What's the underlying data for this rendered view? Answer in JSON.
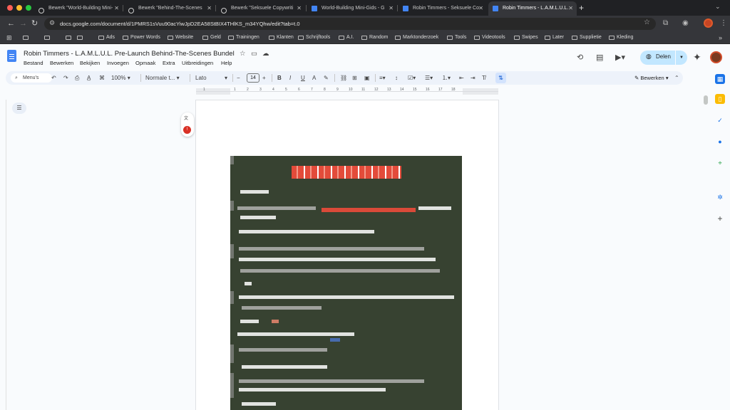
{
  "browser": {
    "tabs": [
      {
        "label": "Bewerk \"World-Building Mini-",
        "icon": "pencil-icon",
        "active": false
      },
      {
        "label": "Bewerk \"Behind-The-Scenes",
        "icon": "pencil-icon",
        "active": false
      },
      {
        "label": "Bewerk \"Seksuele Copywriti",
        "icon": "pencil-icon",
        "active": false
      },
      {
        "label": "World-Building Mini-Gids - G",
        "icon": "docs-icon",
        "active": false
      },
      {
        "label": "Robin Timmers - Seksuele Co",
        "icon": "docs-icon",
        "active": false
      },
      {
        "label": "Robin Timmers - L.A.M.L.U.L.",
        "icon": "docs-icon",
        "active": true
      }
    ],
    "new_tab": "+",
    "url": "docs.google.com/document/d/1PMRS1sVuu90acYiwJpD2EA58StBIX4THlKS_m34YQhw/edit?tab=t.0",
    "bookmarks": [
      "Ads",
      "Power Words",
      "Website",
      "Geld",
      "Trainingen",
      "Klanten",
      "Schrijftools",
      "A.I.",
      "Random",
      "Marktonderzoek",
      "Tools",
      "Videotools",
      "Swipes",
      "Later",
      "Supplietie",
      "Kleding"
    ]
  },
  "doc": {
    "title": "Robin Timmers - L.A.M.L.U.L. Pre-Launch Behind-The-Scenes Bundel",
    "menu": [
      "Bestand",
      "Bewerken",
      "Bekijken",
      "Invoegen",
      "Opmaak",
      "Extra",
      "Uitbreidingen",
      "Help"
    ],
    "share_label": "Delen"
  },
  "toolbar": {
    "search_label": "Menu's",
    "zoom": "100%",
    "style": "Normale t...",
    "font": "Lato",
    "font_size": "14",
    "mode_label": "Bewerken"
  },
  "ruler": {
    "numbers": [
      "1",
      "1",
      "2",
      "3",
      "4",
      "5",
      "6",
      "7",
      "8",
      "9",
      "10",
      "11",
      "12",
      "13",
      "14",
      "15",
      "16",
      "17",
      "18"
    ]
  },
  "colors": {
    "accent": "#0b57d0",
    "share_bg": "#c2e7ff",
    "image_bg": "#374231",
    "redact_red": "#e34b3a"
  }
}
